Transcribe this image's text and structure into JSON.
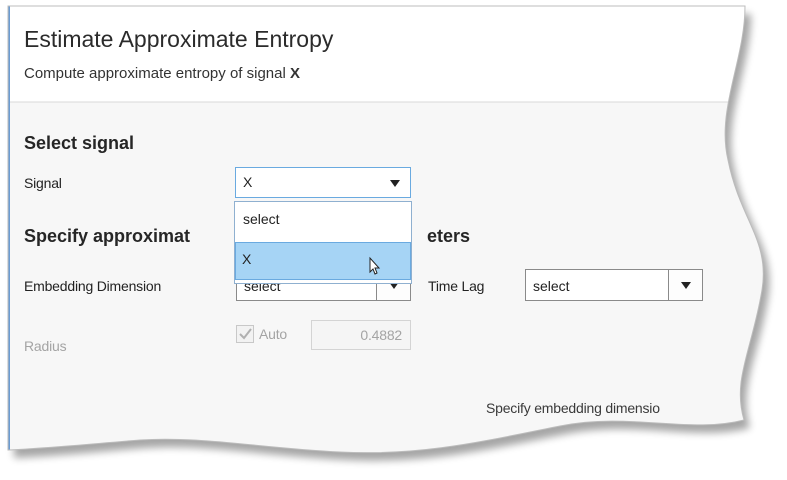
{
  "header": {
    "title": "Estimate Approximate Entropy",
    "subtitle_prefix": "Compute approximate entropy of signal",
    "subtitle_signal": "X"
  },
  "select_signal": {
    "heading": "Select signal",
    "signal_label": "Signal",
    "signal_value": "X",
    "options": [
      "select",
      "X"
    ],
    "highlighted_option": "X"
  },
  "parameters": {
    "heading_left": "Specify approximat",
    "heading_right": "eters",
    "embedding_dimension_label": "Embedding Dimension",
    "embedding_dimension_value": "select",
    "time_lag_label": "Time Lag",
    "time_lag_value": "select",
    "radius_label": "Radius",
    "auto_label": "Auto",
    "auto_checked": true,
    "radius_value": "0.4882"
  },
  "status": {
    "message": "Specify embedding dimensio"
  },
  "colors": {
    "accent_border": "#8fb0d0",
    "selection": "#a6d4f5",
    "panel_left_border": "#6b9bd1"
  }
}
